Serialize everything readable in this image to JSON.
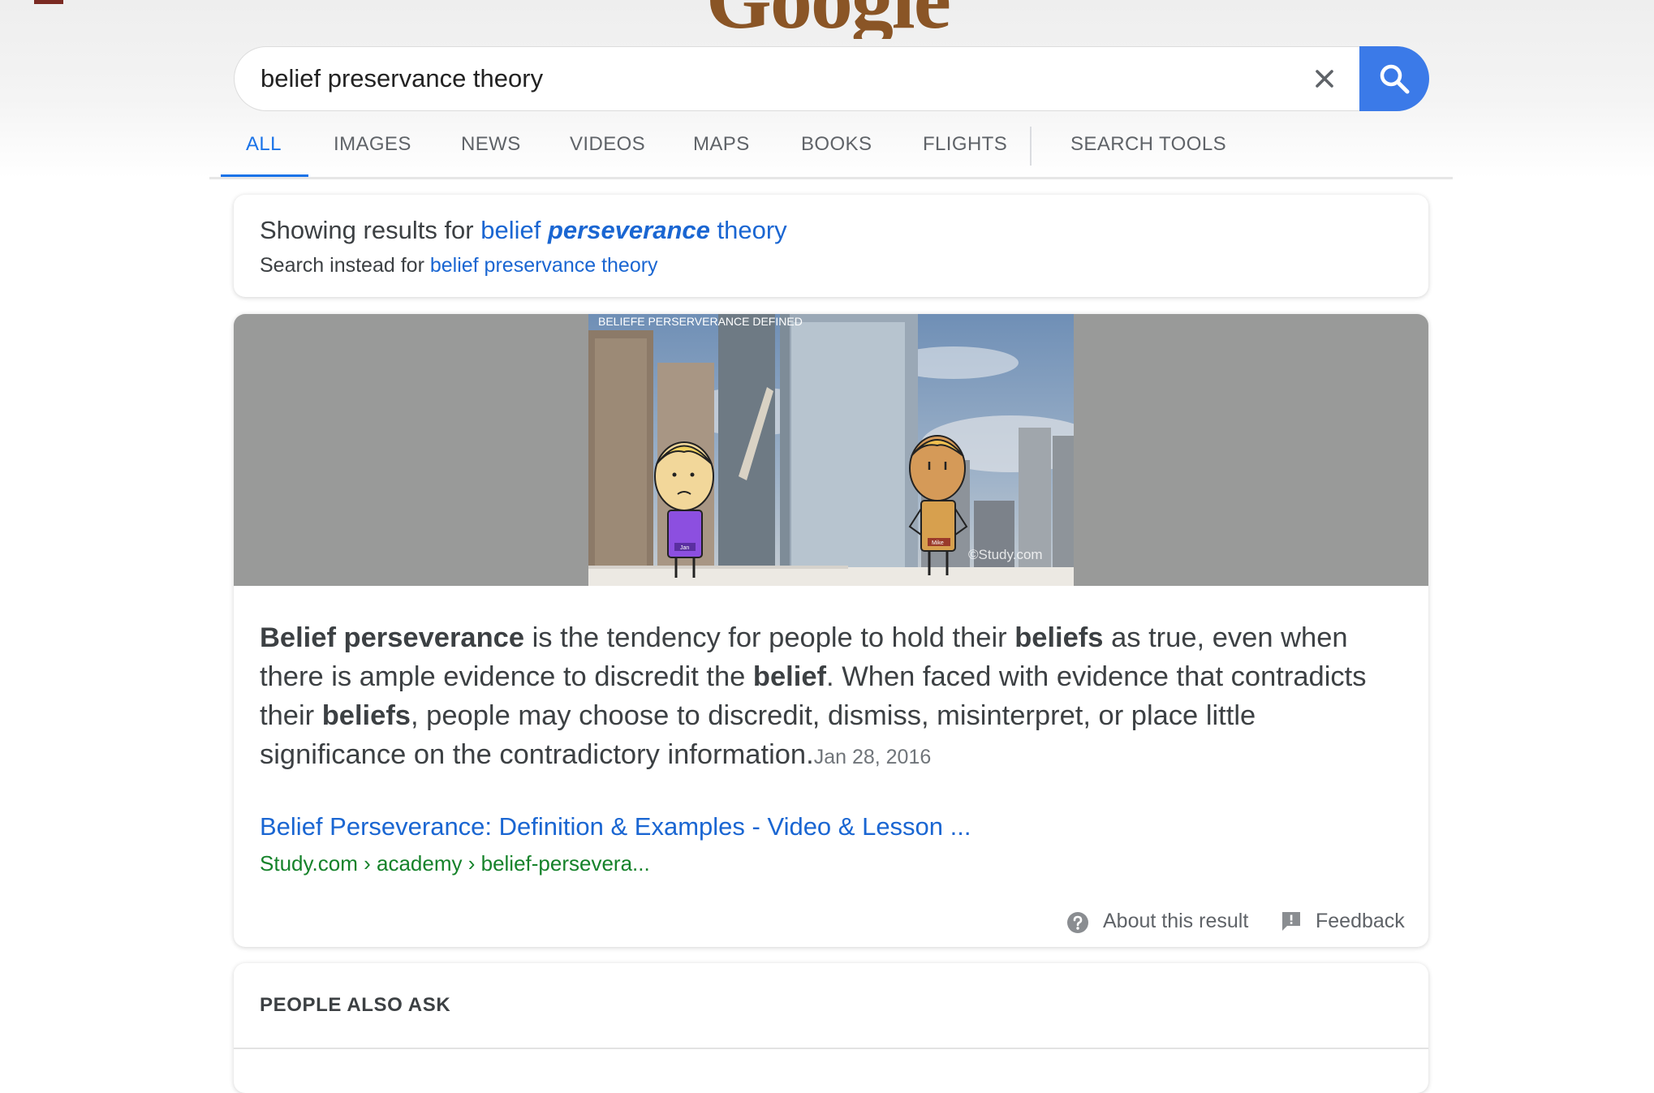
{
  "header": {
    "logo_text": "Google"
  },
  "search": {
    "query": "belief preservance theory",
    "clear_icon": "close-icon",
    "submit_icon": "search-icon",
    "accent_color": "#3b7ae8"
  },
  "tabs": [
    {
      "label": "ALL",
      "active": true
    },
    {
      "label": "IMAGES",
      "active": false
    },
    {
      "label": "NEWS",
      "active": false
    },
    {
      "label": "VIDEOS",
      "active": false
    },
    {
      "label": "MAPS",
      "active": false
    },
    {
      "label": "BOOKS",
      "active": false
    },
    {
      "label": "FLIGHTS",
      "active": false
    },
    {
      "label": "SEARCH TOOLS",
      "active": false
    }
  ],
  "spell": {
    "showing_prefix": "Showing results for ",
    "corrected_word1": "belief ",
    "corrected_word2": "perseverance",
    "corrected_word3": " theory",
    "instead_prefix": "Search instead for ",
    "original_query": "belief preservance theory"
  },
  "snippet": {
    "image_caption": "BELIEFE PERSERVERANCE DEFINED",
    "image_watermark": "©Study.com",
    "character_left_name": "Jan",
    "character_right_name": "Mike",
    "text_parts": [
      {
        "t": "Belief perseverance",
        "b": true
      },
      {
        "t": " is the tendency for people to hold their ",
        "b": false
      },
      {
        "t": "beliefs",
        "b": true
      },
      {
        "t": " as true, even when there is ample evidence to discredit the ",
        "b": false
      },
      {
        "t": "belief",
        "b": true
      },
      {
        "t": ". When faced with evidence that contradicts their ",
        "b": false
      },
      {
        "t": "beliefs",
        "b": true
      },
      {
        "t": ", people may choose to discredit, dismiss, misinterpret, or place little significance on the contradictory information.",
        "b": false
      }
    ],
    "date": "Jan 28, 2016",
    "result_title": "Belief Perseverance: Definition & Examples - Video & Lesson ...",
    "result_url": "Study.com › academy › belief-persevera...",
    "about_label": "About this result",
    "feedback_label": "Feedback"
  },
  "people_also_ask": {
    "title": "PEOPLE ALSO ASK"
  }
}
